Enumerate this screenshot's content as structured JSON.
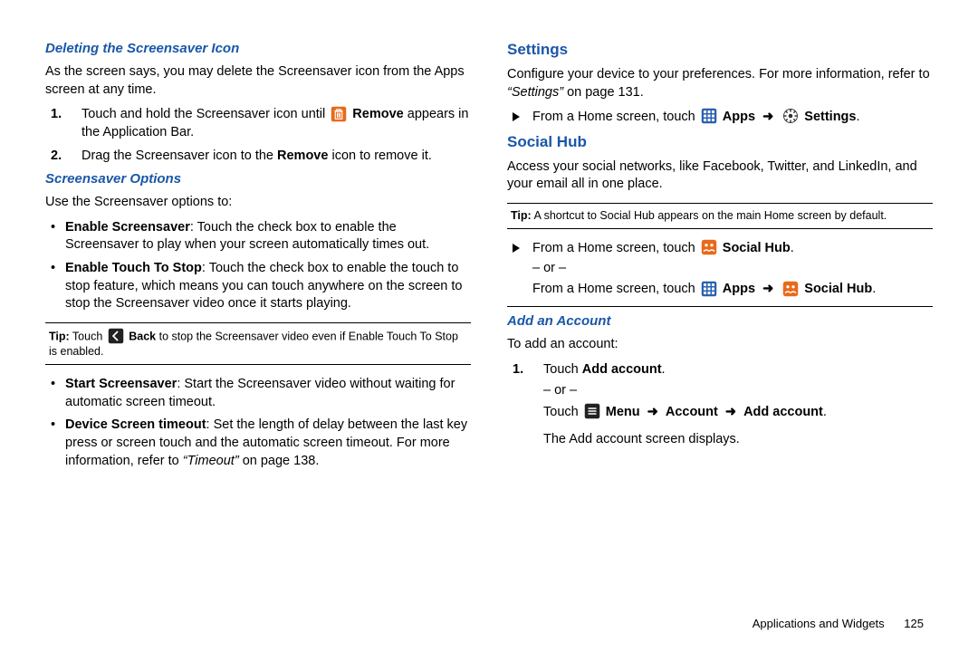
{
  "left": {
    "h_del": "Deleting the Screensaver Icon",
    "del_p": "As the screen says, you may delete the Screensaver icon from the Apps screen at any time.",
    "del_1a": "Touch and hold the Screensaver icon until ",
    "del_1b": "Remove",
    "del_1c": " appears in the Application Bar.",
    "del_2a": "Drag the Screensaver icon to the ",
    "del_2b": "Remove",
    "del_2c": " icon to remove it.",
    "h_opts": "Screensaver Options",
    "opts_intro": "Use the Screensaver options to:",
    "bul1a": "Enable Screensaver",
    "bul1b": ": Touch the check box to enable the Screensaver to play when your screen automatically times out.",
    "bul2a": "Enable Touch To Stop",
    "bul2b": ": Touch the check box to enable the touch to stop feature, which means you can touch anywhere on the screen to stop the Screensaver video once it starts playing.",
    "tip1a": "Tip:",
    "tip1b": " Touch ",
    "tip1c": "Back",
    "tip1d": " to stop the Screensaver video even if Enable Touch To Stop is enabled.",
    "bul3a": "Start Screensaver",
    "bul3b": ": Start the Screensaver video without waiting for automatic screen timeout.",
    "bul4a": "Device Screen timeout",
    "bul4b": ": Set the length of delay between the last key press or screen touch and the automatic screen timeout. For more information, refer to ",
    "bul4c": "“Timeout”",
    "bul4d": " on page 138."
  },
  "right": {
    "h_set": "Settings",
    "set_p1": "Configure your device to your preferences. For more information, refer to ",
    "set_p2": "“Settings”",
    "set_p3": " on page 131.",
    "set_li1": "From a Home screen, touch ",
    "apps": "Apps",
    "settings": "Settings",
    "arrow": "➜",
    "h_soc": "Social Hub",
    "soc_p": "Access your social networks, like Facebook, Twitter, and LinkedIn, and your email all in one place.",
    "tip2a": "Tip:",
    "tip2b": " A shortcut to Social Hub appears on the main Home screen by default.",
    "soc_li1": "From a Home screen, touch ",
    "socialhub": "Social Hub",
    "or": "– or –",
    "soc_li2": "From a Home screen, touch ",
    "h_add": "Add an Account",
    "add_intro": "To add an account:",
    "add1a": "Touch ",
    "add1b": "Add account",
    "add2a": "Touch ",
    "menu": "Menu",
    "account": "Account",
    "addacct": "Add account",
    "add_post": "The Add account screen displays.",
    "dot": "."
  },
  "footer": {
    "section": "Applications and Widgets",
    "page": "125"
  }
}
